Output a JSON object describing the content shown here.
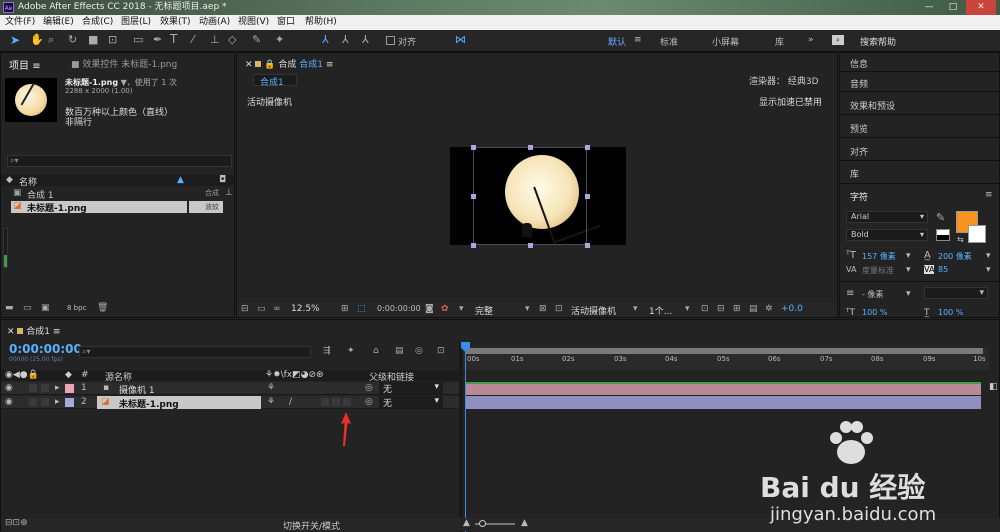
{
  "app": {
    "title": "Adobe After Effects CC 2018 - 无标题项目.aep *",
    "logo": "Ae"
  },
  "menu": [
    "文件(F)",
    "编辑(E)",
    "合成(C)",
    "图层(L)",
    "效果(T)",
    "动画(A)",
    "视图(V)",
    "窗口",
    "帮助(H)"
  ],
  "toolbar": {
    "snap_label": "对齐",
    "workspaces": [
      "默认",
      "标准",
      "小屏幕",
      "库"
    ],
    "search_placeholder": "搜索帮助"
  },
  "project": {
    "tab": "项目",
    "effects_tab": "效果控件 未标题-1.png",
    "asset_name": "未标题-1.png",
    "used": "▼，使用了 1 次",
    "dims": "2288 x 2000 (1.00)",
    "desc1": "数百万种以上颜色（直线）",
    "desc2": "非隔行",
    "col_name": "名称",
    "items": [
      {
        "name": "合成 1",
        "type": "合成"
      },
      {
        "name": "未标题-1.png",
        "type": "波紋"
      }
    ],
    "bpc": "8 bpc"
  },
  "comp": {
    "tab": "合成",
    "tab_name": "合成1",
    "sub_tab": "合成1",
    "renderer_label": "渲染器：",
    "renderer": "经典3D",
    "camera_label": "活动摄像机",
    "gpu_label": "显示加速已禁用",
    "zoom": "12.5%",
    "time": "0:00:00:00",
    "quality": "完整",
    "view": "活动摄像机",
    "views": "1个...",
    "exposure": "+0.0"
  },
  "right_panels": [
    "信息",
    "音频",
    "效果和预设",
    "预览",
    "对齐",
    "库"
  ],
  "character": {
    "title": "字符",
    "font": "Arial",
    "style": "Bold",
    "size": "157 像素",
    "leading": "200 像素",
    "kerning": "度量标准",
    "tracking": "85",
    "unit": "- 像素",
    "scale_v": "100 %",
    "scale_h": "100 %",
    "fill_color": "#f7931e"
  },
  "timeline": {
    "tab": "合成1",
    "timecode": "0:00:00:00",
    "fps": "00000 (25.00 fps)",
    "col_num": "#",
    "col_name": "源名称",
    "col_parent": "父级和链接",
    "layers": [
      {
        "num": "1",
        "name": "摄像机 1",
        "color": "#e8a5b5",
        "parent": "无"
      },
      {
        "num": "2",
        "name": "未标题-1.png",
        "color": "#a8a8dd",
        "parent": "无"
      }
    ],
    "ruler": [
      "00s",
      "01s",
      "02s",
      "03s",
      "04s",
      "05s",
      "06s",
      "07s",
      "08s",
      "09s",
      "10s"
    ],
    "footer": "切换开关/模式"
  },
  "watermark": {
    "brand": "Bai du 经验",
    "url": "jingyan.baidu.com"
  }
}
